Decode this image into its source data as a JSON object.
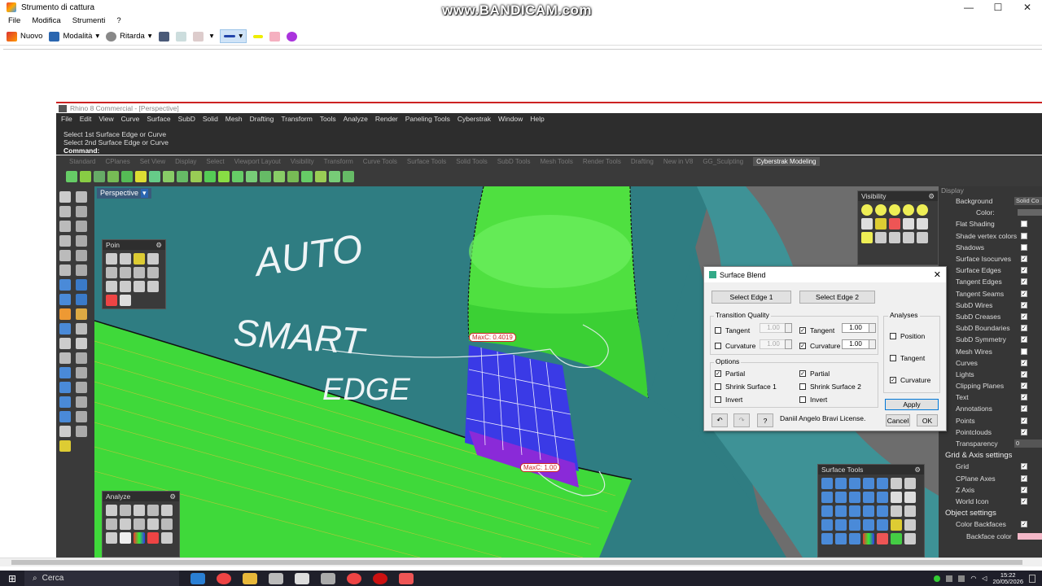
{
  "snip": {
    "title": "Strumento di cattura",
    "watermark": "www.BANDICAM.com",
    "menu": [
      "File",
      "Modifica",
      "Strumenti",
      "?"
    ],
    "toolbar": {
      "new": "Nuovo",
      "mode": "Modalità",
      "delay": "Ritarda"
    }
  },
  "rhino": {
    "title": "Rhino 8 Commercial - [Perspective]",
    "menu": [
      "File",
      "Edit",
      "View",
      "Curve",
      "Surface",
      "SubD",
      "Solid",
      "Mesh",
      "Drafting",
      "Transform",
      "Tools",
      "Analyze",
      "Render",
      "Paneling Tools",
      "Cyberstrak",
      "Window",
      "Help"
    ],
    "history": [
      "Select 1st Surface Edge or Curve",
      "Select 2nd Surface Edge or Curve"
    ],
    "command_label": "Command:",
    "tabs": [
      "Standard",
      "CPlanes",
      "Set View",
      "Display",
      "Select",
      "Viewport Layout",
      "Visibility",
      "Transform",
      "Curve Tools",
      "Surface Tools",
      "Solid Tools",
      "SubD Tools",
      "Mesh Tools",
      "Render Tools",
      "Drafting",
      "New in V8",
      "GG_Sculpting"
    ],
    "active_tab": "Cyberstrak Modeling",
    "viewport_label": "Perspective",
    "panels": {
      "poin": "Poin",
      "analyze": "Analyze",
      "visibility": "Visibility",
      "surface_tools": "Surface Tools"
    },
    "labels": {
      "maxc1": "MaxC: 0.4019",
      "maxc2": "MaxC: 1.00"
    },
    "annotation": [
      "AUTO",
      "SMART",
      "EDGE"
    ]
  },
  "display": {
    "header": "Display",
    "background_label": "Background",
    "background_value": "Solid Co",
    "color_label": "Color:",
    "rows": [
      {
        "label": "Flat Shading",
        "checked": false
      },
      {
        "label": "Shade vertex colors",
        "checked": false
      },
      {
        "label": "Shadows",
        "checked": false
      },
      {
        "label": "Surface Isocurves",
        "checked": true
      },
      {
        "label": "Surface Edges",
        "checked": true
      },
      {
        "label": "Tangent Edges",
        "checked": true
      },
      {
        "label": "Tangent Seams",
        "checked": true
      },
      {
        "label": "SubD Wires",
        "checked": true
      },
      {
        "label": "SubD Creases",
        "checked": true
      },
      {
        "label": "SubD Boundaries",
        "checked": true
      },
      {
        "label": "SubD Symmetry",
        "checked": true
      },
      {
        "label": "Mesh Wires",
        "checked": false
      },
      {
        "label": "Curves",
        "checked": true
      },
      {
        "label": "Lights",
        "checked": true
      },
      {
        "label": "Clipping Planes",
        "checked": true
      },
      {
        "label": "Text",
        "checked": true
      },
      {
        "label": "Annotations",
        "checked": true
      },
      {
        "label": "Points",
        "checked": true
      },
      {
        "label": "Pointclouds",
        "checked": true
      }
    ],
    "transparency_label": "Transparency",
    "transparency_value": "0",
    "grid_section": "Grid & Axis settings",
    "grid_rows": [
      {
        "label": "Grid",
        "checked": true
      },
      {
        "label": "CPlane Axes",
        "checked": true
      },
      {
        "label": "Z Axis",
        "checked": true
      },
      {
        "label": "World Icon",
        "checked": true
      }
    ],
    "object_section": "Object settings",
    "backfaces_label": "Color Backfaces",
    "backface_color_label": "Backface color",
    "backface_color": "#f4b8c8"
  },
  "dialog": {
    "title": "Surface Blend",
    "select_edge1": "Select Edge 1",
    "select_edge2": "Select Edge 2",
    "transition_quality": "Transition Quality",
    "tangent": "Tangent",
    "curvature": "Curvature",
    "val_disabled": "1.00",
    "val_tangent": "1.00",
    "val_curvature": "1.00",
    "options": "Options",
    "partial": "Partial",
    "shrink1": "Shrink Surface 1",
    "shrink2": "Shrink Surface 2",
    "invert": "Invert",
    "analyses": "Analyses",
    "position": "Position",
    "an_tangent": "Tangent",
    "an_curvature": "Curvature",
    "apply": "Apply",
    "license": "Daniil Angelo Bravi License.",
    "help": "?",
    "cancel": "Cancel",
    "ok": "OK"
  },
  "taskbar": {
    "search_placeholder": "Cerca",
    "time": "15:22",
    "date": "20/05/2026"
  }
}
